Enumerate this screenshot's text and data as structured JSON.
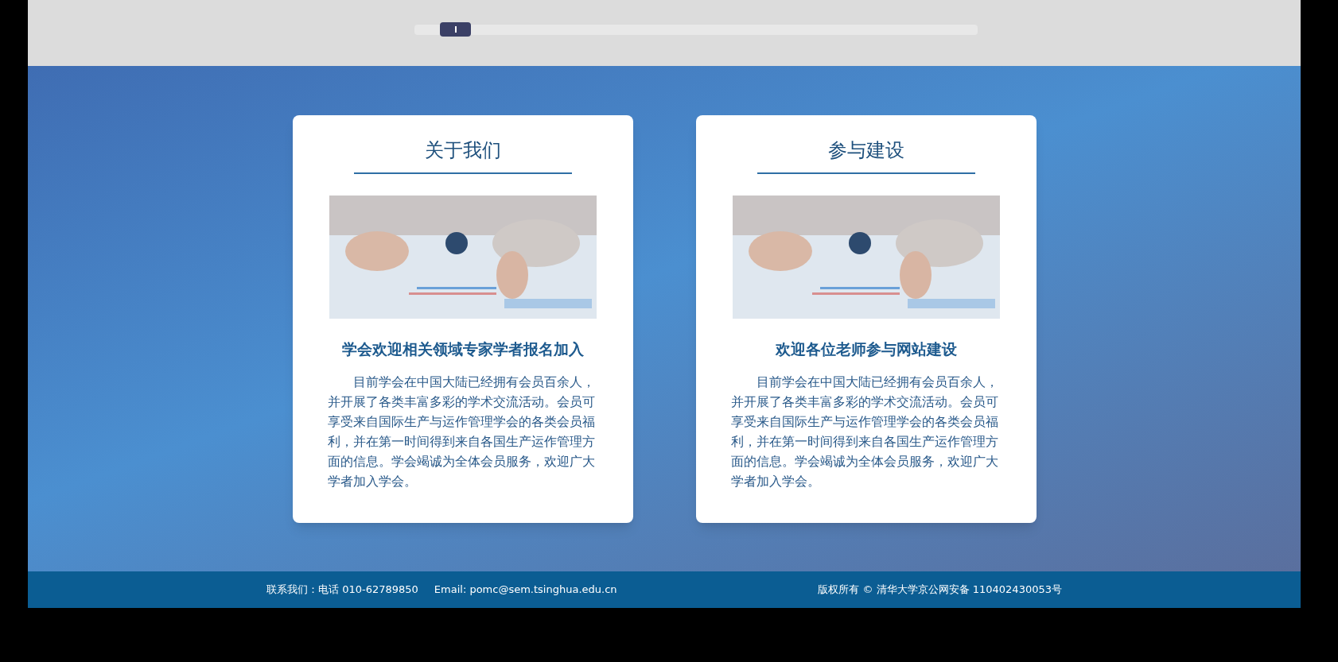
{
  "cards": [
    {
      "title": "关于我们",
      "headline": "学会欢迎相关领域专家学者报名加入",
      "body": "目前学会在中国大陆已经拥有会员百余人，并开展了各类丰富多彩的学术交流活动。会员可享受来自国际生产与运作管理学会的各类会员福利，并在第一时间得到来自各国生产运作管理方面的信息。学会竭诚为全体会员服务，欢迎广大学者加入学会。"
    },
    {
      "title": "参与建设",
      "headline": "欢迎各位老师参与网站建设",
      "body": "目前学会在中国大陆已经拥有会员百余人，并开展了各类丰富多彩的学术交流活动。会员可享受来自国际生产与运作管理学会的各类会员福利，并在第一时间得到来自各国生产运作管理方面的信息。学会竭诚为全体会员服务，欢迎广大学者加入学会。"
    }
  ],
  "footer": {
    "contact": "联系我们：电话 010-62789850",
    "email": "Email: pomc@sem.tsinghua.edu.cn",
    "copyright": "版权所有 © 清华大学京公网安备 110402430053号"
  }
}
